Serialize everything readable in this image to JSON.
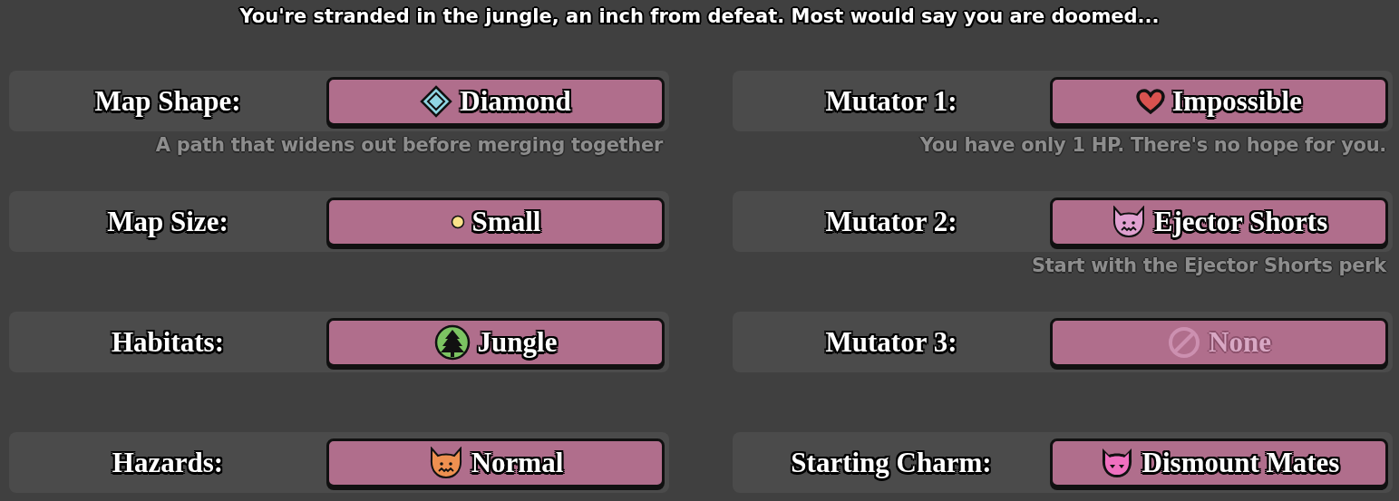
{
  "header": "You're stranded in the jungle, an inch from defeat. Most would say you are doomed...",
  "settings": [
    {
      "label": "Map Shape:",
      "value": "Diamond",
      "kind": "diamond",
      "disabled": false,
      "description": "A path that widens out before merging together"
    },
    {
      "label": "Mutator 1:",
      "value": "Impossible",
      "kind": "heart",
      "disabled": false,
      "description": "You have only 1 HP. There's no hope for you."
    },
    {
      "label": "Map Size:",
      "value": "Small",
      "kind": "dot",
      "disabled": false
    },
    {
      "label": "Mutator 2:",
      "value": "Ejector Shorts",
      "kind": "devil",
      "color": "#e0a0d0",
      "disabled": false,
      "description": "Start with the Ejector Shorts perk"
    },
    {
      "label": "Habitats:",
      "value": "Jungle",
      "kind": "tree",
      "disabled": false
    },
    {
      "label": "Mutator 3:",
      "value": "None",
      "kind": "none",
      "disabled": true
    },
    {
      "label": "Hazards:",
      "value": "Normal",
      "kind": "devil",
      "color": "#ee9050",
      "disabled": false
    },
    {
      "label": "Starting Charm:",
      "value": "Dismount Mates",
      "kind": "charm",
      "color": "#f070c0",
      "disabled": false
    }
  ]
}
